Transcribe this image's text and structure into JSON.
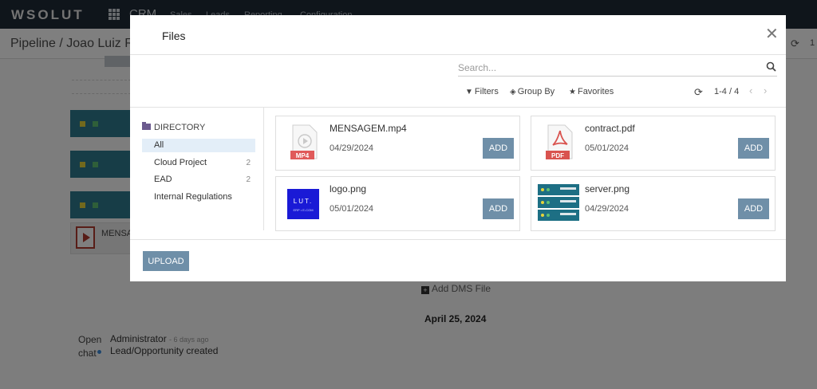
{
  "navbar": {
    "brand": "WSOLUT",
    "app": "CRM",
    "menus": [
      "Sales",
      "Leads",
      "Reporting",
      "Configuration"
    ]
  },
  "page": {
    "breadcrumb": "Pipeline / Joao Luiz Ro",
    "pager_partial": "1",
    "background_file_name": "MENSA",
    "add_dms_label": "Add DMS File",
    "date_separator": "April 25, 2024",
    "message": {
      "open_chat": "Open chat",
      "author": "Administrator",
      "time": "- 6 days ago",
      "body": "Lead/Opportunity created"
    }
  },
  "modal": {
    "title": "Files",
    "search": {
      "placeholder": "Search..."
    },
    "filters_label": "Filters",
    "group_by_label": "Group By",
    "favorites_label": "Favorites",
    "pager": "1-4 / 4",
    "directory_header": "DIRECTORY",
    "directories": [
      {
        "label": "All",
        "count": ""
      },
      {
        "label": "Cloud Project",
        "count": "2"
      },
      {
        "label": "EAD",
        "count": "2"
      },
      {
        "label": "Internal Regulations",
        "count": ""
      }
    ],
    "files": [
      {
        "name": "MENSAGEM.mp4",
        "date": "04/29/2024",
        "icon": "mp4-file-icon",
        "badge": "MP4"
      },
      {
        "name": "contract.pdf",
        "date": "05/01/2024",
        "icon": "pdf-file-icon",
        "badge": "PDF"
      },
      {
        "name": "logo.png",
        "date": "05/01/2024",
        "icon": "logo-thumbnail",
        "thumb_text": "LUT.",
        "thumb_subtext": "ERP • E-COM"
      },
      {
        "name": "server.png",
        "date": "04/29/2024",
        "icon": "server-thumbnail"
      }
    ],
    "add_label": "ADD",
    "upload_label": "UPLOAD"
  },
  "colors": {
    "navbar": "#1f2a36",
    "button": "#6f8fa8",
    "active_directory": "#e3eef8",
    "pdf_red": "#d9534f",
    "folder": "#6b5a8e"
  }
}
